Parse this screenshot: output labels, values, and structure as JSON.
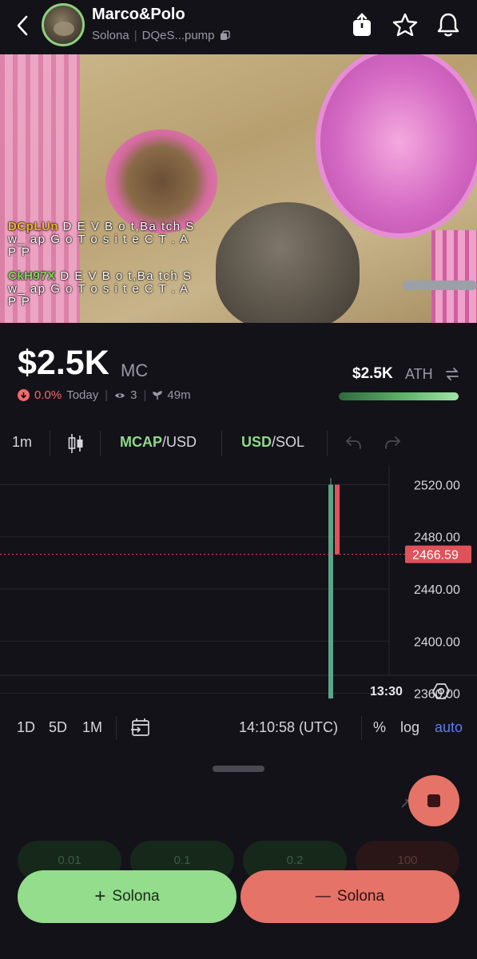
{
  "header": {
    "token_name": "Marco&Polo",
    "chain": "Solona",
    "address": "DQeS...pump"
  },
  "stream": {
    "messages": [
      {
        "user": "DCpLUn",
        "text": "D E V  B o t,Ba tch S w_ ap  G o T o s i t e  C T . A P P"
      },
      {
        "user": "CkH97X",
        "text": "D E V  B o t,Ba tch S w_ ap  G o T o s i t e  C T . A P P"
      }
    ]
  },
  "market": {
    "mc_value": "$2.5K",
    "mc_label": "MC",
    "change_pct": "0.0%",
    "change_period": "Today",
    "viewers": "3",
    "age": "49m",
    "ath_value": "$2.5K",
    "ath_label": "ATH",
    "ath_progress": 1.0,
    "colors": {
      "up": "#8ed98a",
      "down": "#ee6b6b",
      "accent": "#5b7cf6"
    }
  },
  "chart_toolbar": {
    "interval": "1m",
    "mcap_label": "MCAP",
    "mcap_suffix": "/USD",
    "usd_label": "USD",
    "usd_suffix": "/SOL"
  },
  "chart_data": {
    "type": "candlestick",
    "y_ticks": [
      "2520.00",
      "2480.00",
      "2440.00",
      "2400.00",
      "2360.00"
    ],
    "ylim": [
      2345,
      2535
    ],
    "current_price": 2466.59,
    "current_price_label": "2466.59",
    "time_label": "13:30",
    "candles": [
      {
        "open": 2356,
        "close": 2520,
        "high": 2525,
        "low": 2356,
        "direction": "up"
      },
      {
        "open": 2520,
        "close": 2466.59,
        "high": 2520,
        "low": 2466.59,
        "direction": "down"
      }
    ]
  },
  "bottom_toolbar": {
    "ranges": [
      "1D",
      "5D",
      "1M"
    ],
    "clock": "14:10:58 (UTC)",
    "percent": "%",
    "log": "log",
    "auto": "auto"
  },
  "amounts": [
    "0.01",
    "0.1",
    "0.2",
    "100"
  ],
  "actions": {
    "buy_symbol": "+",
    "buy_label": "Solona",
    "sell_symbol": "—",
    "sell_label": "Solona"
  }
}
